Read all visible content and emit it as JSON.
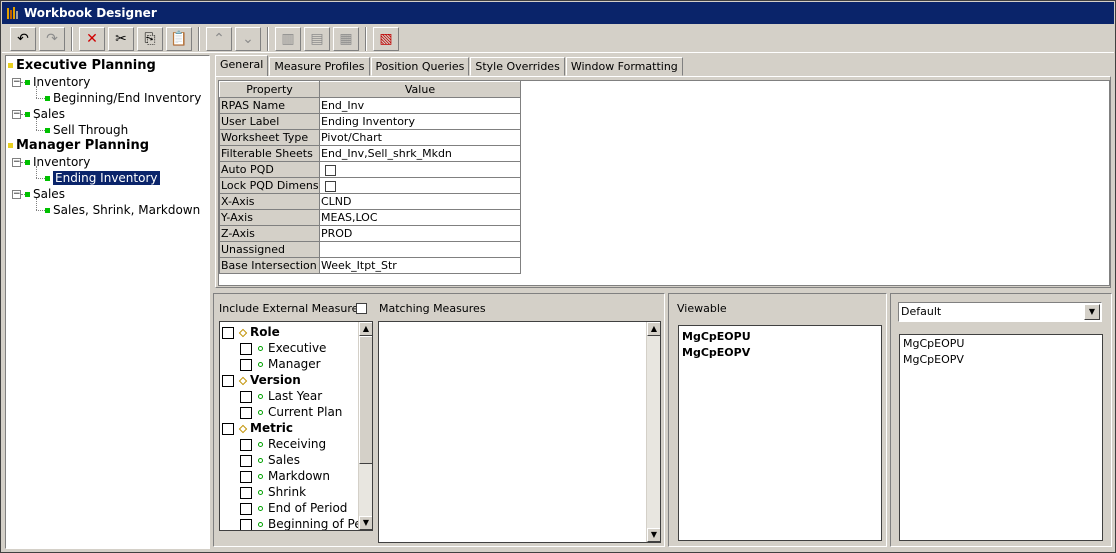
{
  "window": {
    "title": "Workbook Designer"
  },
  "toolbar": {
    "buttons": [
      {
        "name": "undo-icon",
        "glyph": "↶",
        "enabled": true
      },
      {
        "name": "redo-icon",
        "glyph": "↷",
        "enabled": false
      },
      {
        "name": "delete-icon",
        "glyph": "✕",
        "enabled": true
      },
      {
        "name": "cut-icon",
        "glyph": "✂",
        "enabled": true
      },
      {
        "name": "copy-icon",
        "glyph": "⎘",
        "enabled": true
      },
      {
        "name": "paste-icon",
        "glyph": "📋",
        "enabled": true
      },
      {
        "name": "move-up-icon",
        "glyph": "⌃",
        "enabled": false
      },
      {
        "name": "move-down-icon",
        "glyph": "⌄",
        "enabled": false
      },
      {
        "name": "books-icon",
        "glyph": "▥",
        "enabled": false
      },
      {
        "name": "window-icon",
        "glyph": "▤",
        "enabled": false
      },
      {
        "name": "grid-icon",
        "glyph": "▦",
        "enabled": false
      },
      {
        "name": "format-icon",
        "glyph": "▧",
        "enabled": true
      }
    ]
  },
  "tree": {
    "nodes": [
      {
        "label": "Executive Planning",
        "level": 0,
        "root": true
      },
      {
        "label": "Inventory",
        "level": 1,
        "expander": "−"
      },
      {
        "label": "Beginning/End Inventory",
        "level": 2
      },
      {
        "label": "Sales",
        "level": 1,
        "expander": "−"
      },
      {
        "label": "Sell Through",
        "level": 2
      },
      {
        "label": "Manager Planning",
        "level": 0,
        "root": true
      },
      {
        "label": "Inventory",
        "level": 1,
        "expander": "−"
      },
      {
        "label": "Ending Inventory",
        "level": 2,
        "selected": true
      },
      {
        "label": "Sales",
        "level": 1,
        "expander": "−"
      },
      {
        "label": "Sales, Shrink, Markdown",
        "level": 2
      }
    ]
  },
  "tabs": [
    {
      "label": "General",
      "active": true
    },
    {
      "label": "Measure Profiles"
    },
    {
      "label": "Position Queries"
    },
    {
      "label": "Style Overrides"
    },
    {
      "label": "Window Formatting"
    }
  ],
  "properties": {
    "header_property": "Property",
    "header_value": "Value",
    "rows": [
      {
        "property": "RPAS Name",
        "value": "End_Inv"
      },
      {
        "property": "User Label",
        "value": "Ending Inventory"
      },
      {
        "property": "Worksheet Type",
        "value": "Pivot/Chart"
      },
      {
        "property": "Filterable Sheets",
        "value": "End_Inv,Sell_shrk_Mkdn"
      },
      {
        "property": "Auto PQD",
        "value": "",
        "checkbox": true
      },
      {
        "property": "Lock PQD Dimensi...",
        "value": "",
        "checkbox": true
      },
      {
        "property": "X-Axis",
        "value": "CLND"
      },
      {
        "property": "Y-Axis",
        "value": "MEAS,LOC"
      },
      {
        "property": "Z-Axis",
        "value": "PROD"
      },
      {
        "property": "Unassigned",
        "value": ""
      },
      {
        "property": "Base Intersection",
        "value": "Week_Itpt_Str"
      }
    ]
  },
  "measures": {
    "include_external_label": "Include External Measures",
    "matching_label": "Matching Measures",
    "items": [
      {
        "label": "Role",
        "group": true
      },
      {
        "label": "Executive"
      },
      {
        "label": "Manager"
      },
      {
        "label": "Version",
        "group": true
      },
      {
        "label": "Last Year"
      },
      {
        "label": "Current Plan"
      },
      {
        "label": "Metric",
        "group": true
      },
      {
        "label": "Receiving"
      },
      {
        "label": "Sales"
      },
      {
        "label": "Markdown"
      },
      {
        "label": "Shrink"
      },
      {
        "label": "End of Period"
      },
      {
        "label": "Beginning of Pe"
      }
    ]
  },
  "viewable": {
    "label": "Viewable",
    "items": [
      "MgCpEOPU",
      "MgCpEOPV"
    ]
  },
  "profile": {
    "selected": "Default",
    "items": [
      "MgCpEOPU",
      "MgCpEOPV"
    ]
  }
}
